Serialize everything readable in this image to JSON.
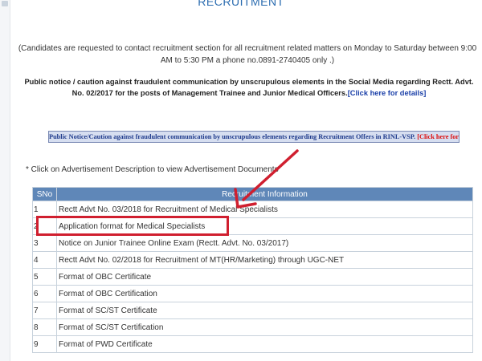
{
  "page": {
    "title": "RECRUITMENT"
  },
  "contact_note": "(Candidates are requested to contact recruitment section for all recruitment related matters on Monday to Saturday between 9:00 AM to 5:30 PM a phone no.0891-2740405 only .)",
  "fraud_notice": {
    "text": "Public notice / caution against fraudulent communication by unscrupulous elements in the Social Media regarding Rectt. Advt. No. 02/2017 for the posts of Management Trainee and Junior Medical Officers.",
    "link": "[Click here for details]"
  },
  "notice_banner": {
    "text": "Public Notice/Caution against fraudulent communication by unscrupulous elements regarding Recruitment Offers in RINL-VSP.",
    "link": "[Click here for details]"
  },
  "instruction": "* Click on Advertisement Description to view Advertisement Documents",
  "table": {
    "headers": {
      "sno": "SNo",
      "info": "Recruitment Information"
    },
    "rows": [
      {
        "sno": "1",
        "desc": "Rectt Advt No. 03/2018 for Recruitment of Medical Specialists"
      },
      {
        "sno": "2",
        "desc": "Application format for Medical Specialists"
      },
      {
        "sno": "3",
        "desc": "Notice on Junior Trainee Online Exam (Rectt. Advt. No. 03/2017)"
      },
      {
        "sno": "4",
        "desc": "Rectt Advt No. 02/2018 for Recruitment of MT(HR/Marketing) through UGC-NET"
      },
      {
        "sno": "5",
        "desc": "Format of OBC Certificate"
      },
      {
        "sno": "6",
        "desc": "Format of OBC Certification"
      },
      {
        "sno": "7",
        "desc": "Format of SC/ST Certificate"
      },
      {
        "sno": "8",
        "desc": "Format of SC/ST Certification"
      },
      {
        "sno": "9",
        "desc": "Format of PWD Certificate"
      }
    ]
  },
  "colors": {
    "header_bg": "#5f87b8",
    "title_blue": "#2b6cb0",
    "annotation_red": "#d01f2f",
    "link_red": "#dd1111"
  }
}
